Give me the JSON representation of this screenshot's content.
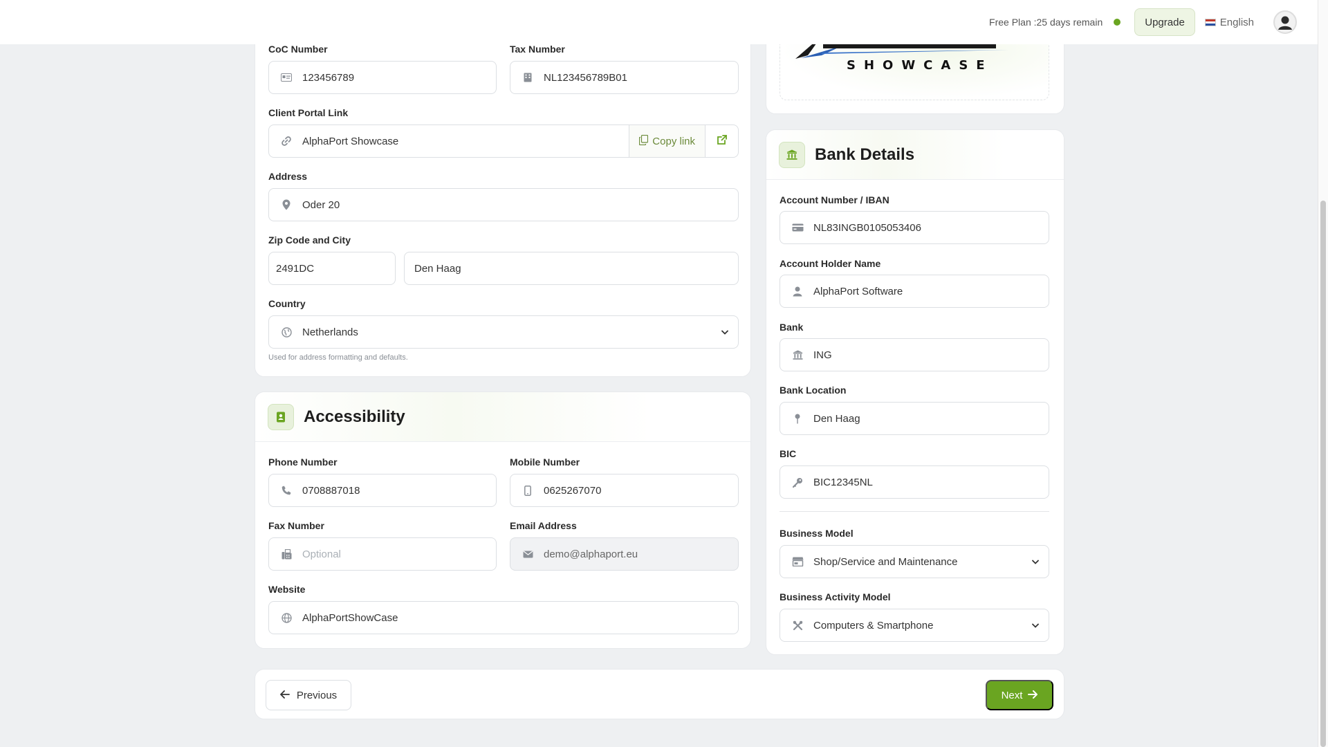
{
  "topbar": {
    "plan_text": "Free Plan :25 days remain",
    "upgrade_label": "Upgrade",
    "language": "English"
  },
  "company": {
    "coc_label": "CoC Number",
    "coc_value": "123456789",
    "tax_label": "Tax Number",
    "tax_value": "NL123456789B01",
    "portal_label": "Client Portal Link",
    "portal_value": "AlphaPort Showcase",
    "copy_link_label": "Copy link",
    "address_label": "Address",
    "address_value": "Oder 20",
    "zip_city_label": "Zip Code and City",
    "zip_value": "2491DC",
    "city_value": "Den Haag",
    "country_label": "Country",
    "country_value": "Netherlands",
    "country_helper": "Used for address formatting and defaults."
  },
  "accessibility": {
    "title": "Accessibility",
    "phone_label": "Phone Number",
    "phone_value": "0708887018",
    "mobile_label": "Mobile Number",
    "mobile_value": "0625267070",
    "fax_label": "Fax Number",
    "fax_placeholder": "Optional",
    "email_label": "Email Address",
    "email_value": "demo@alphaport.eu",
    "website_label": "Website",
    "website_value": "AlphaPortShowCase"
  },
  "logo": {
    "wordmark": "SHOWCASE"
  },
  "bank": {
    "title": "Bank Details",
    "iban_label": "Account Number / IBAN",
    "iban_value": "NL83INGB0105053406",
    "holder_label": "Account Holder Name",
    "holder_value": "AlphaPort Software",
    "bank_label": "Bank",
    "bank_value": "ING",
    "location_label": "Bank Location",
    "location_value": "Den Haag",
    "bic_label": "BIC",
    "bic_value": "BIC12345NL",
    "business_model_label": "Business Model",
    "business_model_value": "Shop/Service and Maintenance",
    "activity_label": "Business Activity Model",
    "activity_value": "Computers & Smartphone"
  },
  "nav": {
    "previous_label": "Previous",
    "next_label": "Next"
  },
  "colors": {
    "accent": "#6aa521",
    "accent_light": "#e8f1dc"
  }
}
